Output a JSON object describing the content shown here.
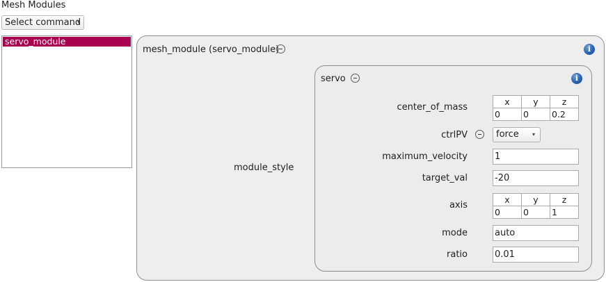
{
  "header": {
    "title": "Mesh Modules"
  },
  "command_select": {
    "value": "Select command",
    "arrow": "▾"
  },
  "module_list": {
    "items": [
      "servo_module"
    ],
    "selected": "servo_module"
  },
  "outer_panel": {
    "title": "mesh_module (servo_module)",
    "info": "i",
    "property_label": "module_style"
  },
  "servo_panel": {
    "title": "servo",
    "info": "i",
    "center_of_mass": {
      "label": "center_of_mass",
      "headers": [
        "x",
        "y",
        "z"
      ],
      "values": [
        "0",
        "0",
        "0.2"
      ]
    },
    "ctrlPV": {
      "label": "ctrlPV",
      "value": "force",
      "arrow": "▾"
    },
    "maximum_velocity": {
      "label": "maximum_velocity",
      "value": "1"
    },
    "target_val": {
      "label": "target_val",
      "value": "-20"
    },
    "axis": {
      "label": "axis",
      "headers": [
        "x",
        "y",
        "z"
      ],
      "values": [
        "0",
        "0",
        "1"
      ]
    },
    "mode": {
      "label": "mode",
      "value": "auto"
    },
    "ratio": {
      "label": "ratio",
      "value": "0.01"
    }
  },
  "colors": {
    "selection": "#a8004f",
    "panel": "#eeeeee",
    "info": "#2a62b4"
  }
}
